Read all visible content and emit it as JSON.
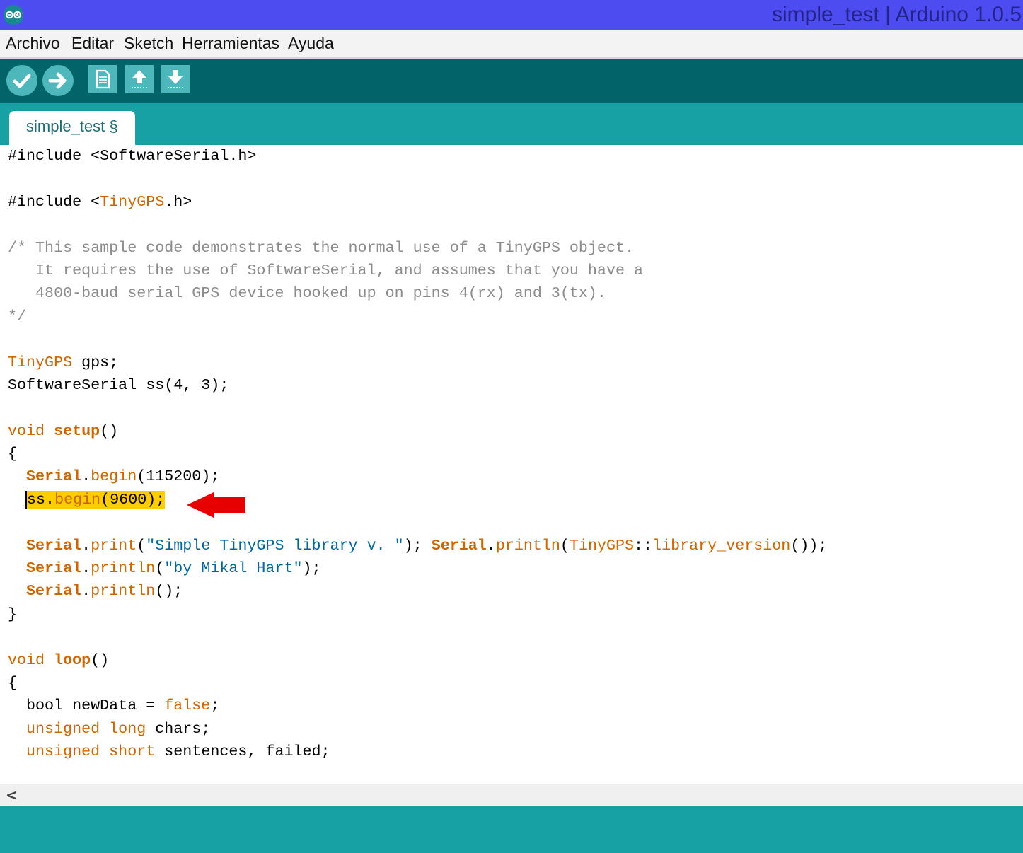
{
  "window": {
    "title": "simple_test | Arduino 1.0.5",
    "logo_icon": "arduino-infinity-icon"
  },
  "menubar": {
    "items": [
      "Archivo",
      "Editar",
      "Sketch",
      "Herramientas",
      "Ayuda"
    ]
  },
  "toolbar": {
    "buttons": [
      {
        "name": "verify-button",
        "icon": "checkmark-icon"
      },
      {
        "name": "upload-button",
        "icon": "arrow-right-icon"
      },
      {
        "name": "new-button",
        "icon": "document-icon"
      },
      {
        "name": "open-button",
        "icon": "arrow-up-icon"
      },
      {
        "name": "save-button",
        "icon": "arrow-down-icon"
      }
    ]
  },
  "tabs": [
    {
      "label": "simple_test §",
      "active": true
    }
  ],
  "editor": {
    "lines": [
      [
        {
          "t": "#include <SoftwareSerial.h>"
        }
      ],
      [],
      [
        {
          "t": "#include <"
        },
        {
          "t": "TinyGPS",
          "c": "kw"
        },
        {
          "t": ".h>"
        }
      ],
      [],
      [
        {
          "t": "/* This sample code demonstrates the normal use of a TinyGPS object.",
          "c": "cm"
        }
      ],
      [
        {
          "t": "   It requires the use of SoftwareSerial, and assumes that you have a",
          "c": "cm"
        }
      ],
      [
        {
          "t": "   4800-baud serial GPS device hooked up on pins 4(rx) and 3(tx).",
          "c": "cm"
        }
      ],
      [
        {
          "t": "*/",
          "c": "cm"
        }
      ],
      [],
      [
        {
          "t": "TinyGPS",
          "c": "kw"
        },
        {
          "t": " gps;"
        }
      ],
      [
        {
          "t": "SoftwareSerial ss(4, 3);"
        }
      ],
      [],
      [
        {
          "t": "void",
          "c": "kw"
        },
        {
          "t": " "
        },
        {
          "t": "setup",
          "c": "fn"
        },
        {
          "t": "()"
        }
      ],
      [
        {
          "t": "{"
        }
      ],
      [
        {
          "t": "  "
        },
        {
          "t": "Serial",
          "c": "fn"
        },
        {
          "t": "."
        },
        {
          "t": "begin",
          "c": "kw"
        },
        {
          "t": "(115200);"
        }
      ],
      [
        {
          "t": "  "
        },
        {
          "t": "ss.",
          "c": "hl cursor"
        },
        {
          "t": "begin",
          "c": "kw hl"
        },
        {
          "t": "(9600);",
          "c": "hl"
        }
      ],
      [],
      [
        {
          "t": "  "
        },
        {
          "t": "Serial",
          "c": "fn"
        },
        {
          "t": "."
        },
        {
          "t": "print",
          "c": "kw"
        },
        {
          "t": "("
        },
        {
          "t": "\"Simple TinyGPS library v. \"",
          "c": "st"
        },
        {
          "t": "); "
        },
        {
          "t": "Serial",
          "c": "fn"
        },
        {
          "t": "."
        },
        {
          "t": "println",
          "c": "kw"
        },
        {
          "t": "("
        },
        {
          "t": "TinyGPS",
          "c": "kw"
        },
        {
          "t": "::"
        },
        {
          "t": "library_version",
          "c": "kw"
        },
        {
          "t": "());"
        }
      ],
      [
        {
          "t": "  "
        },
        {
          "t": "Serial",
          "c": "fn"
        },
        {
          "t": "."
        },
        {
          "t": "println",
          "c": "kw"
        },
        {
          "t": "("
        },
        {
          "t": "\"by Mikal Hart\"",
          "c": "st"
        },
        {
          "t": ");"
        }
      ],
      [
        {
          "t": "  "
        },
        {
          "t": "Serial",
          "c": "fn"
        },
        {
          "t": "."
        },
        {
          "t": "println",
          "c": "kw"
        },
        {
          "t": "();"
        }
      ],
      [
        {
          "t": "}"
        }
      ],
      [],
      [
        {
          "t": "void",
          "c": "kw"
        },
        {
          "t": " "
        },
        {
          "t": "loop",
          "c": "fn"
        },
        {
          "t": "()"
        }
      ],
      [
        {
          "t": "{"
        }
      ],
      [
        {
          "t": "  bool newData = "
        },
        {
          "t": "false",
          "c": "kw"
        },
        {
          "t": ";"
        }
      ],
      [
        {
          "t": "  "
        },
        {
          "t": "unsigned",
          "c": "kw"
        },
        {
          "t": " "
        },
        {
          "t": "long",
          "c": "kw"
        },
        {
          "t": " chars;"
        }
      ],
      [
        {
          "t": "  "
        },
        {
          "t": "unsigned",
          "c": "kw"
        },
        {
          "t": " "
        },
        {
          "t": "short",
          "c": "kw"
        },
        {
          "t": " sentences, failed;"
        }
      ]
    ]
  },
  "annotation": {
    "icon": "red-arrow-icon",
    "color": "#e60000"
  },
  "scrollbar": {
    "left_icon": "<"
  },
  "colors": {
    "titlebar": "#4c4cf0",
    "toolbar": "#006468",
    "tabbar": "#17a1a5",
    "button": "#4db7bb",
    "highlight": "#ffcc00",
    "keyword": "#cc6600",
    "string": "#006699",
    "comment": "#8c8c8c"
  }
}
